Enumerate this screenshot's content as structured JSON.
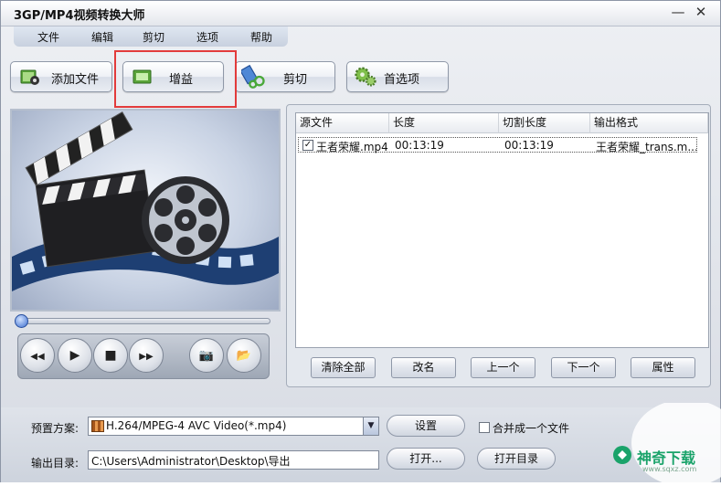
{
  "window": {
    "title": "3GP/MP4视频转换大师",
    "minimize_glyph": "—",
    "close_glyph": "✕"
  },
  "menu": [
    "文件",
    "编辑",
    "剪切",
    "选项",
    "帮助"
  ],
  "toolbar": {
    "add_file": "添加文件",
    "gain": "增益",
    "cut": "剪切",
    "preferences": "首选项"
  },
  "player": {
    "progress": 0.0,
    "buttons": [
      "rewind-icon",
      "play-icon",
      "stop-icon",
      "fast-forward-icon",
      "camera-icon",
      "folder-icon"
    ],
    "glyphs": {
      "rewind": "◀◀",
      "play": "▶",
      "stop": "■",
      "ff": "▶▶",
      "camera": "📷",
      "folder": "📂"
    }
  },
  "file_list": {
    "headers": [
      "源文件",
      "长度",
      "切割长度",
      "输出格式"
    ],
    "rows": [
      {
        "checked": true,
        "check_glyph": "✓",
        "source": "王者荣耀.mp4",
        "length": "00:13:19",
        "cut_length": "00:13:19",
        "output": "王者荣耀_trans.m..."
      }
    ]
  },
  "list_actions": {
    "clear_all": "清除全部",
    "rename": "改名",
    "move_up": "上一个",
    "move_down": "下一个",
    "properties": "属性"
  },
  "settings": {
    "preset_label": "预置方案:",
    "preset_value": "H.264/MPEG-4 AVC Video(*.mp4)",
    "settings_button": "设置",
    "merge_label": "合并成一个文件",
    "merge_checked": false,
    "output_label": "输出目录:",
    "output_path": "C:\\Users\\Administrator\\Desktop\\导出",
    "open_button": "打开...",
    "open_dir_button": "打开目录"
  },
  "watermark": {
    "text": "神奇下载",
    "subtext": "www.sqxz.com"
  },
  "colors": {
    "highlight": "#e23b3b",
    "watermark_green": "#1aa36a"
  }
}
